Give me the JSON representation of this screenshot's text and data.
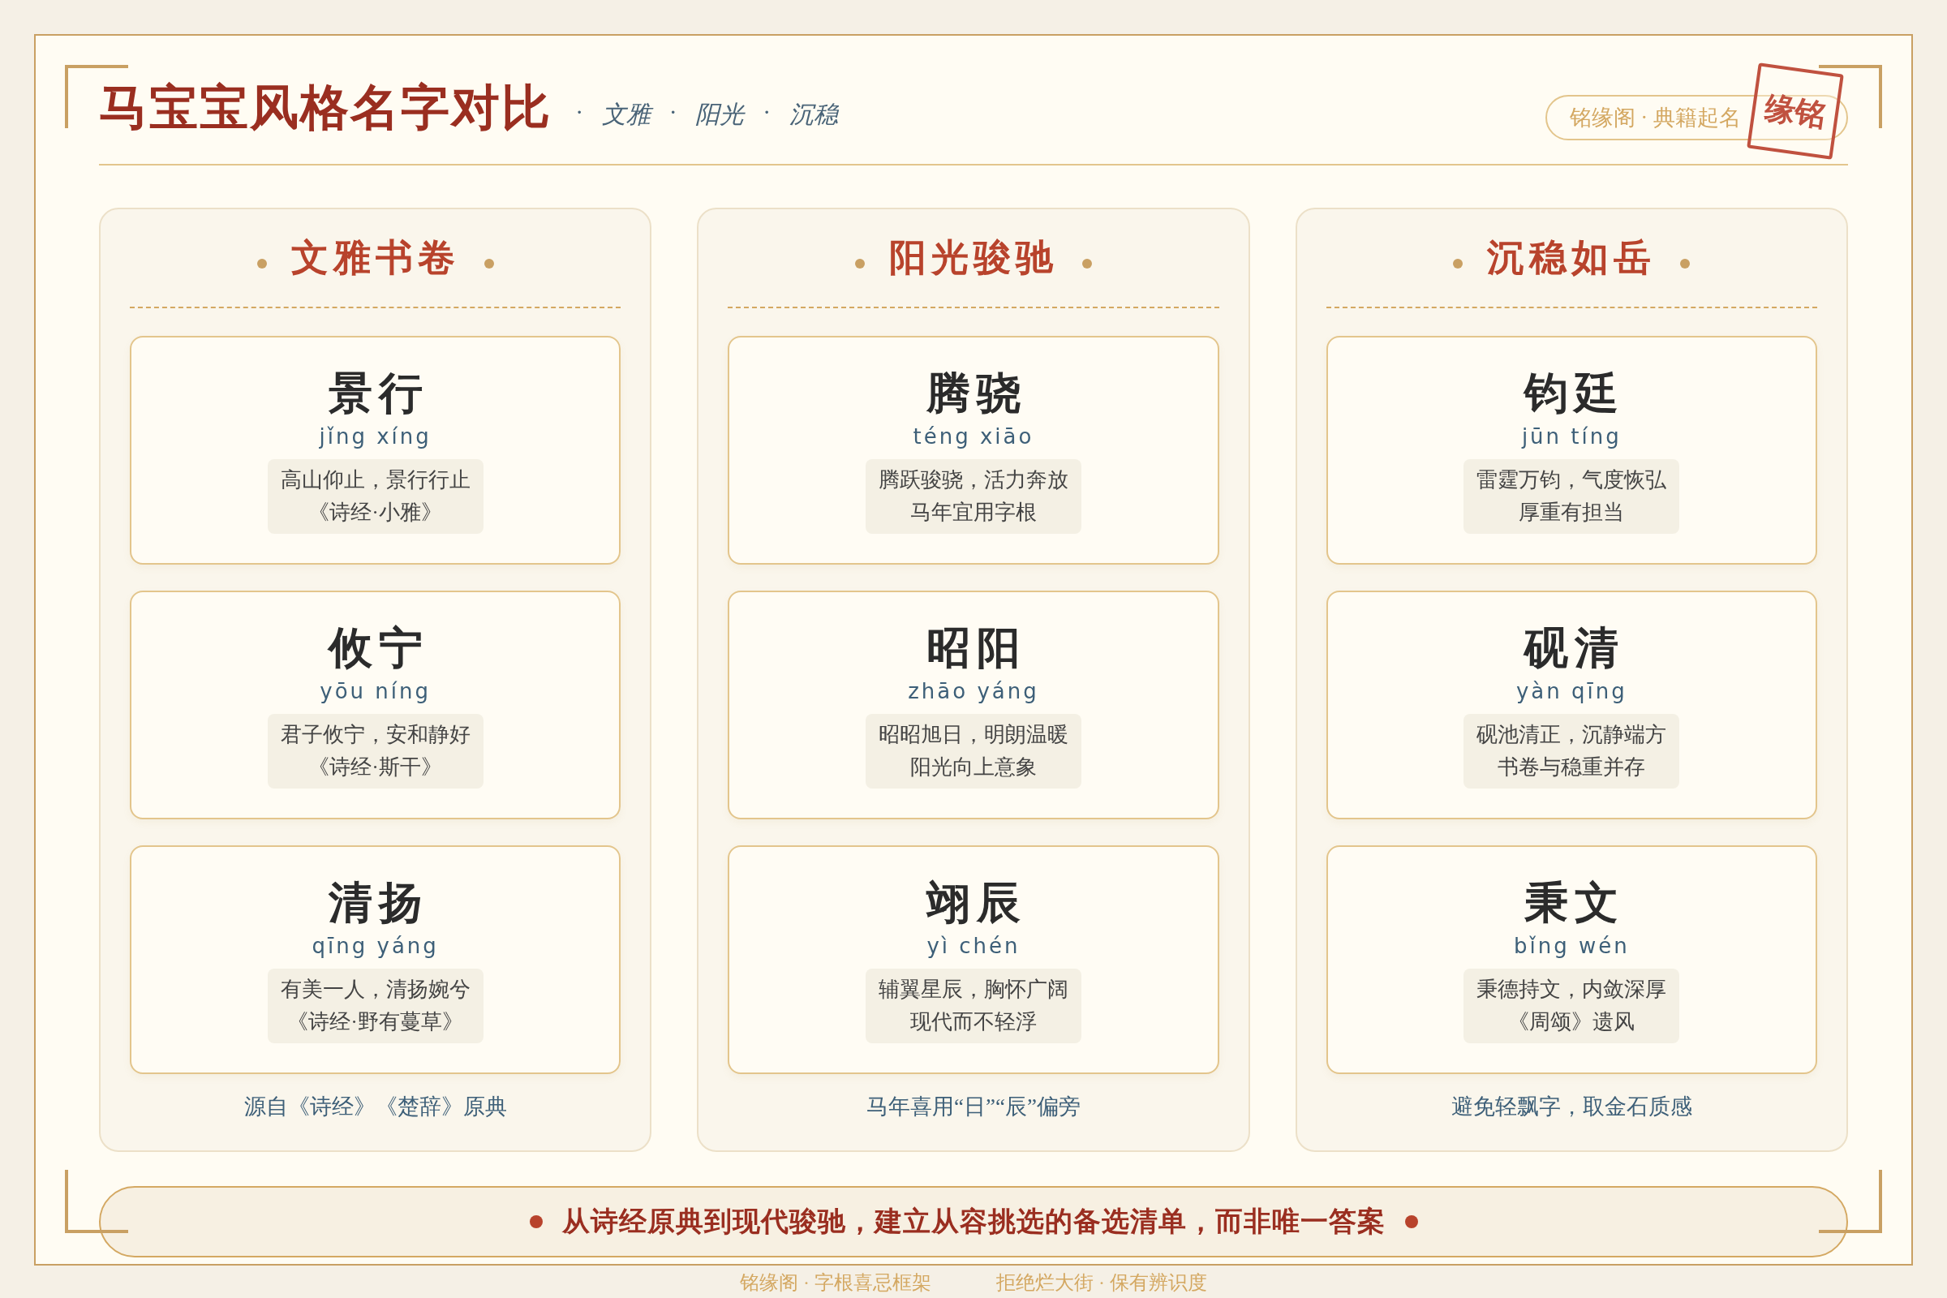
{
  "title": "马宝宝风格名字对比",
  "subtitle": {
    "separator": "·",
    "items": [
      "文雅",
      "阳光",
      "沉稳"
    ]
  },
  "badge": "铭缘阁 · 典籍起名",
  "stamp": "缘铭",
  "columns": [
    {
      "title": "文雅书卷",
      "names": [
        {
          "name": "景行",
          "pinyin": "jǐng xíng",
          "quote": [
            "高山仰止，景行行止",
            "《诗经·小雅》"
          ]
        },
        {
          "name": "攸宁",
          "pinyin": "yōu níng",
          "quote": [
            "君子攸宁，安和静好",
            "《诗经·斯干》"
          ]
        },
        {
          "name": "清扬",
          "pinyin": "qīng yáng",
          "quote": [
            "有美一人，清扬婉兮",
            "《诗经·野有蔓草》"
          ]
        }
      ],
      "note": "源自《诗经》《楚辞》原典"
    },
    {
      "title": "阳光骏驰",
      "names": [
        {
          "name": "腾骁",
          "pinyin": "téng xiāo",
          "quote": [
            "腾跃骏骁，活力奔放",
            "马年宜用字根"
          ]
        },
        {
          "name": "昭阳",
          "pinyin": "zhāo yáng",
          "quote": [
            "昭昭旭日，明朗温暖",
            "阳光向上意象"
          ]
        },
        {
          "name": "翊辰",
          "pinyin": "yì chén",
          "quote": [
            "辅翼星辰，胸怀广阔",
            "现代而不轻浮"
          ]
        }
      ],
      "note": "马年喜用“日”“辰”偏旁"
    },
    {
      "title": "沉稳如岳",
      "names": [
        {
          "name": "钧廷",
          "pinyin": "jūn tíng",
          "quote": [
            "雷霆万钧，气度恢弘",
            "厚重有担当"
          ]
        },
        {
          "name": "砚清",
          "pinyin": "yàn qīng",
          "quote": [
            "砚池清正，沉静端方",
            "书卷与稳重并存"
          ]
        },
        {
          "name": "秉文",
          "pinyin": "bǐng wén",
          "quote": [
            "秉德持文，内敛深厚",
            "《周颂》遗风"
          ]
        }
      ],
      "note": "避免轻飘字，取金石质感"
    }
  ],
  "banner": "从诗经原典到现代骏驰，建立从容挑选的备选清单，而非唯一答案",
  "footer": [
    "铭缘阁 · 字根喜忌框架",
    "拒绝烂大街 · 保有辨识度"
  ]
}
